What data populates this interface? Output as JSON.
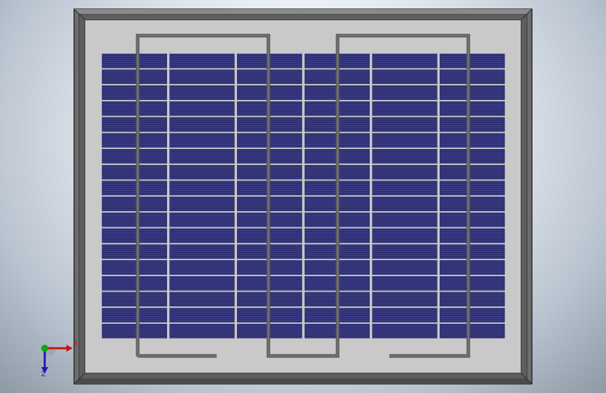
{
  "view": {
    "background_colors": [
      "#ffffff",
      "#b9c3cf",
      "#8e99a6"
    ]
  },
  "model": {
    "frame_color": "#6d6d6d",
    "frame_dark": "#3a3a3a",
    "backsheet_color": "#c9c9c9",
    "cell_color": "#2e3072",
    "cell_line_color": "#3c3f8a",
    "busbar_color": "#5a5a5a",
    "cell_columns": 6,
    "cell_rows": 18
  },
  "triad": {
    "x_label": "X",
    "z_label": "Z",
    "x_color": "#cc1111",
    "y_color": "#11a611",
    "z_color": "#1a1ab0"
  }
}
